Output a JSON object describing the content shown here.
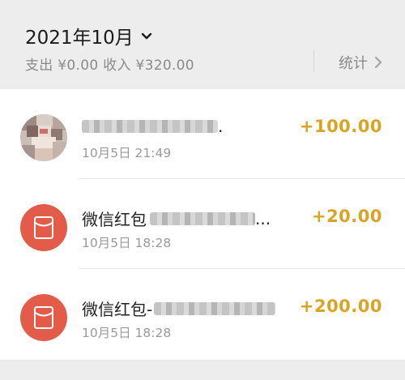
{
  "header": {
    "month_label": "2021年10月",
    "summary": "支出 ¥0.00 收入 ¥320.00",
    "stats_label": "统计"
  },
  "transactions": [
    {
      "title": "",
      "title_suffix": ".",
      "date": "10月5日 21:49",
      "amount": "+100.00",
      "icon": "user-avatar"
    },
    {
      "title": "微信红包",
      "title_suffix": "...",
      "date": "10月5日 18:28",
      "amount": "+20.00",
      "icon": "red-packet-icon"
    },
    {
      "title": "微信红包-",
      "title_suffix": "",
      "date": "10月5日 18:28",
      "amount": "+200.00",
      "icon": "red-packet-icon"
    }
  ],
  "colors": {
    "amount": "#d9a324",
    "red_packet": "#e25c49"
  }
}
